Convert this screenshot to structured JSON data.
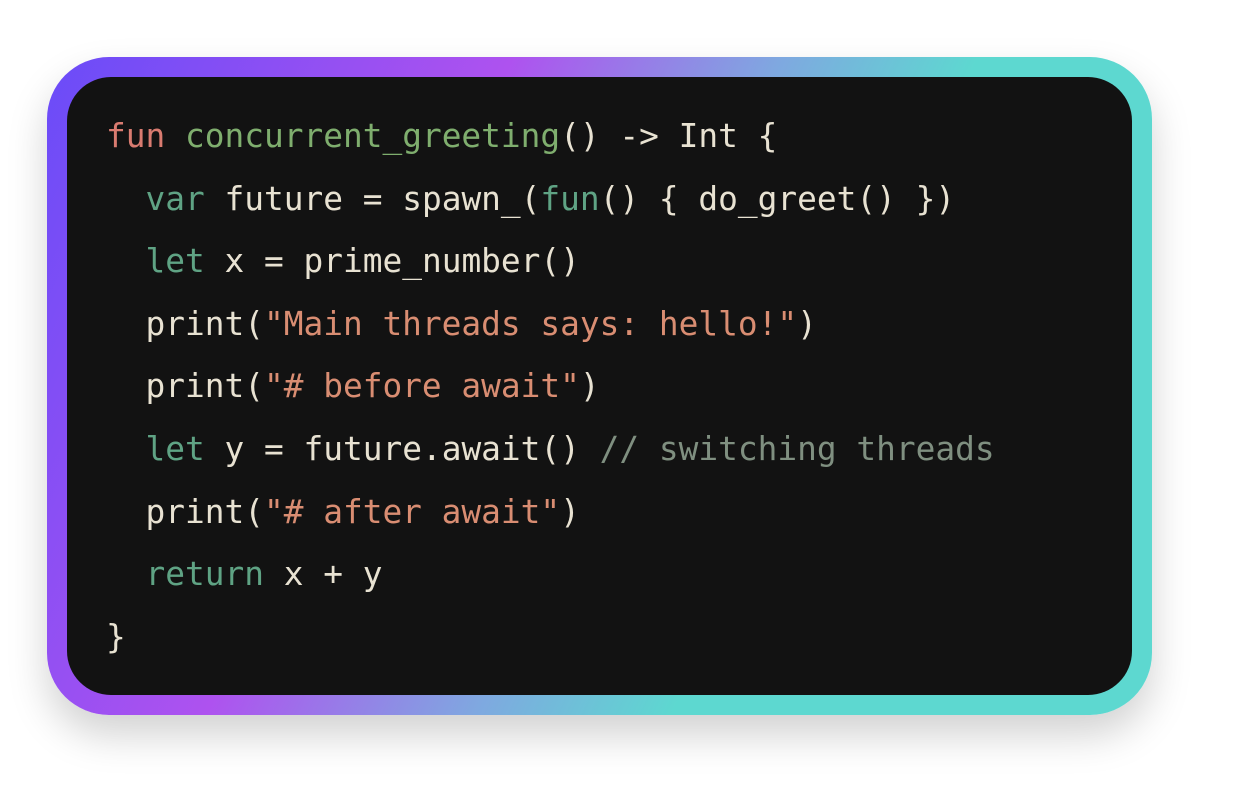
{
  "code": {
    "language_hint": "code snippet",
    "lines": [
      [
        [
          "kw",
          "fun"
        ],
        [
          "plain",
          " "
        ],
        [
          "fn",
          "concurrent_greeting"
        ],
        [
          "plain",
          "() -> Int {"
        ]
      ],
      [
        [
          "plain",
          "  "
        ],
        [
          "kw2",
          "var"
        ],
        [
          "plain",
          " future = spawn_("
        ],
        [
          "kw2",
          "fun"
        ],
        [
          "plain",
          "() { do_greet() })"
        ]
      ],
      [
        [
          "plain",
          "  "
        ],
        [
          "kw2",
          "let"
        ],
        [
          "plain",
          " x = prime_number()"
        ]
      ],
      [
        [
          "plain",
          "  print("
        ],
        [
          "str",
          "\"Main threads says: hello!\""
        ],
        [
          "plain",
          ")"
        ]
      ],
      [
        [
          "plain",
          "  print("
        ],
        [
          "str",
          "\"# before await\""
        ],
        [
          "plain",
          ")"
        ]
      ],
      [
        [
          "plain",
          "  "
        ],
        [
          "kw2",
          "let"
        ],
        [
          "plain",
          " y = future.await() "
        ],
        [
          "com",
          "// switching threads"
        ]
      ],
      [
        [
          "plain",
          "  print("
        ],
        [
          "str",
          "\"# after await\""
        ],
        [
          "plain",
          ")"
        ]
      ],
      [
        [
          "plain",
          "  "
        ],
        [
          "kw2",
          "return"
        ],
        [
          "plain",
          " x + y"
        ]
      ],
      [
        [
          "plain",
          "}"
        ]
      ]
    ]
  },
  "colors": {
    "background": "#121212",
    "keyword_fun": "#d97b70",
    "function_name": "#7fae6e",
    "keyword": "#5fa384",
    "string": "#d98d72",
    "comment": "#7f8f80",
    "text": "#e8e2d2",
    "gradient": [
      "#6a4cf8",
      "#ae52ef",
      "#5dd8d0"
    ]
  }
}
